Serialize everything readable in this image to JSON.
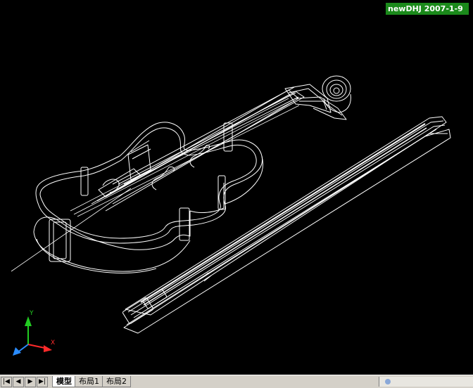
{
  "viewport": {
    "background": "#000000",
    "stamp_text": "newDHJ 2007-1-9",
    "stamp_color": "#1b8a1b",
    "ucs_icon": {
      "y_label": "Y",
      "x_label": "X",
      "y_color": "#22cc22",
      "x_color": "#ff2a2a",
      "z_color": "#2a8cff"
    },
    "drawing": "violin-and-bow-wireframe"
  },
  "tabbar": {
    "nav_buttons": [
      {
        "name": "first-layout-button",
        "glyph": "|◀"
      },
      {
        "name": "prev-layout-button",
        "glyph": "◀"
      },
      {
        "name": "next-layout-button",
        "glyph": "▶"
      },
      {
        "name": "last-layout-button",
        "glyph": "▶|"
      }
    ],
    "tabs": [
      {
        "label": "模型",
        "active": true
      },
      {
        "label": "布局1",
        "active": false
      },
      {
        "label": "布局2",
        "active": false
      }
    ]
  }
}
